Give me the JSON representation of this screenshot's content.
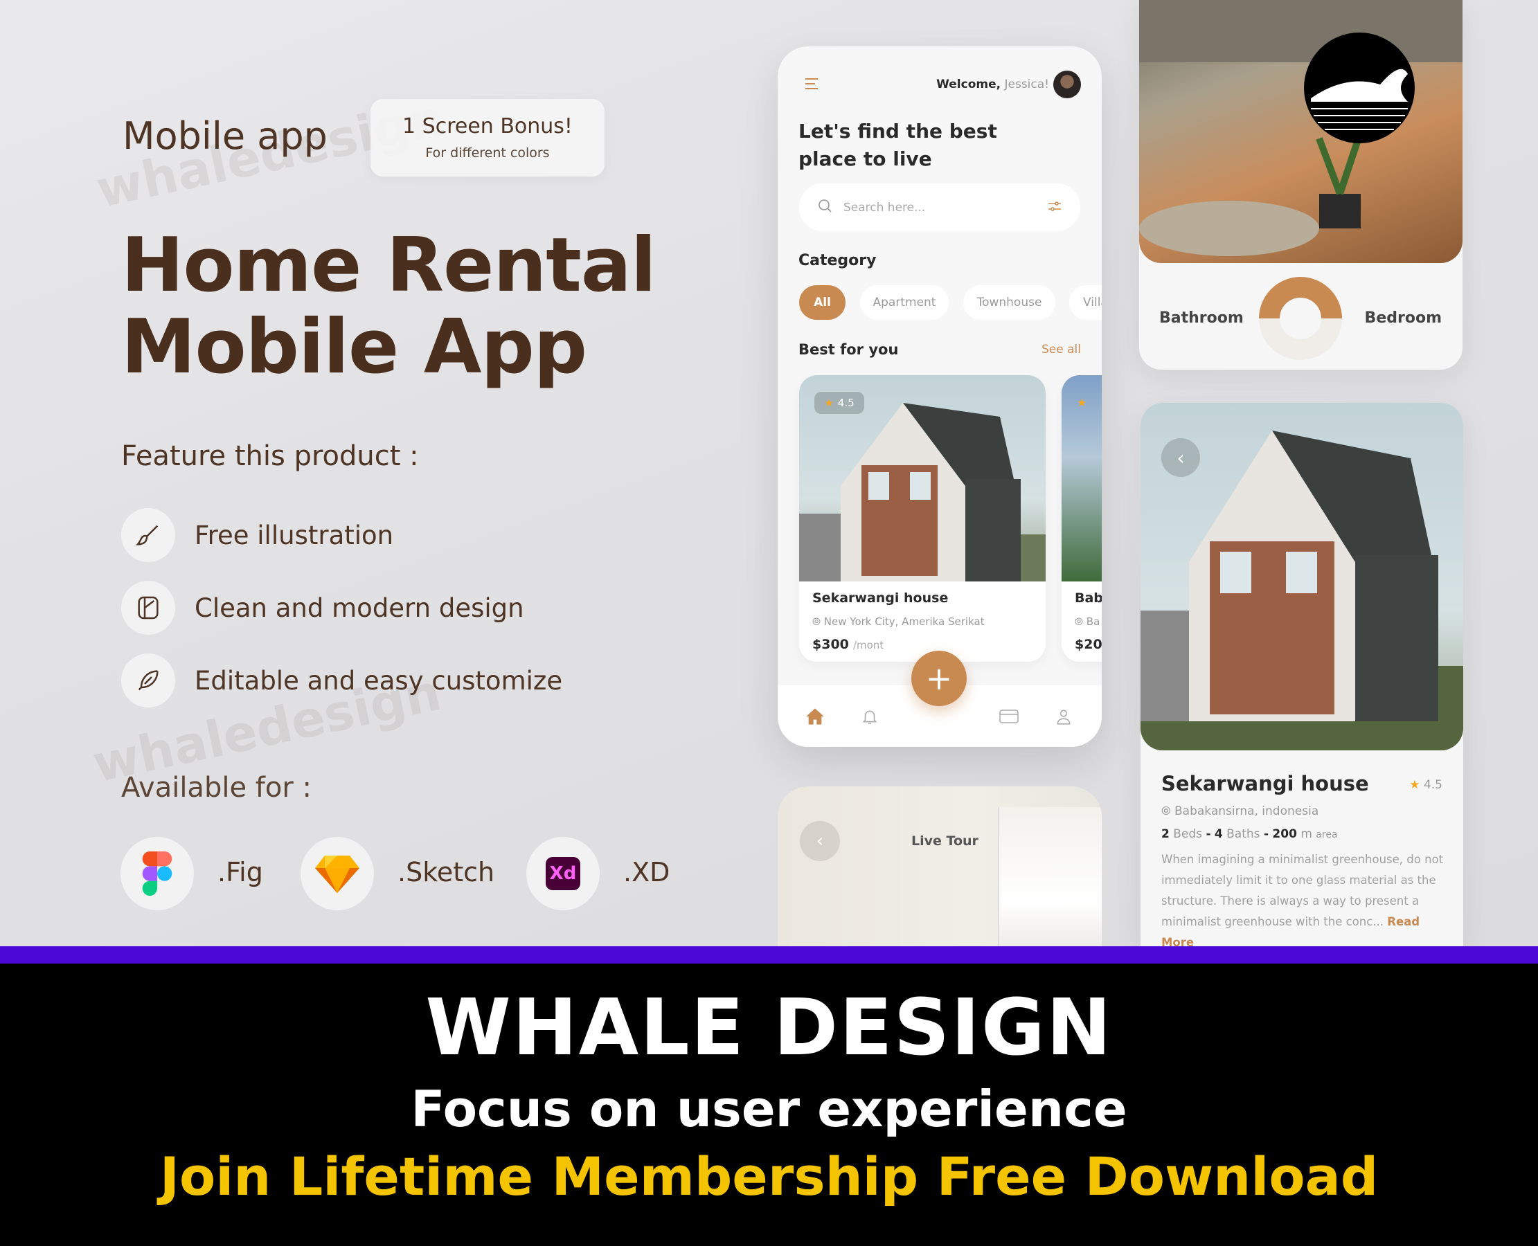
{
  "watermark": "whaledesign",
  "promo": {
    "subtitle": "Mobile app",
    "bonus_title": "1 Screen Bonus!",
    "bonus_sub": "For different colors",
    "title_line1": "Home Rental",
    "title_line2": "Mobile App",
    "features_heading": "Feature this product :",
    "features": [
      {
        "icon": "brush-icon",
        "label": "Free illustration"
      },
      {
        "icon": "design-tool-icon",
        "label": "Clean and modern design"
      },
      {
        "icon": "feather-pen-icon",
        "label": "Editable and easy customize"
      }
    ],
    "available_heading": "Available for :",
    "platforms": [
      {
        "icon": "figma-icon",
        "label": ".Fig"
      },
      {
        "icon": "sketch-icon",
        "label": ".Sketch"
      },
      {
        "icon": "adobe-xd-icon",
        "label": ".XD",
        "glyph": "Xd"
      }
    ]
  },
  "home_screen": {
    "welcome": "Welcome,",
    "user": "Jessica!",
    "heading_line1": "Let's find the best",
    "heading_line2": "place to live",
    "search_placeholder": "Search here...",
    "category_label": "Category",
    "categories": [
      "All",
      "Apartment",
      "Townhouse",
      "Villa"
    ],
    "selected_category": "All",
    "best_label": "Best for you",
    "see_all": "See all",
    "cards": [
      {
        "rating": "4.5",
        "name": "Sekarwangi house",
        "location": "New York City, Amerika Serikat",
        "price": "$300",
        "unit": "/mont"
      },
      {
        "name": "Bab",
        "location": "Ba",
        "price": "$20"
      }
    ],
    "nav": [
      "home-icon",
      "bell-icon",
      "card-icon",
      "user-icon"
    ],
    "accent": "#c98a52"
  },
  "tour_screen": {
    "label": "Live Tour"
  },
  "room_card": {
    "left": "Bathroom",
    "right": "Bedroom"
  },
  "detail_screen": {
    "name": "Sekarwangi house",
    "rating": "4.5",
    "location": "Babakansirna, indonesia",
    "beds": "2",
    "beds_label": "Beds",
    "baths": "4",
    "baths_label": "Baths",
    "area": "200",
    "area_unit": "m",
    "area_label": "area",
    "sep": "-",
    "description": "When imagining a minimalist greenhouse, do not immediately limit it to one glass material as the structure. There is always a way to present a minimalist greenhouse with the conc...",
    "read_more": "Read More"
  },
  "banner": {
    "brand": "WHALE DESIGN",
    "tagline": "Focus on user experience",
    "cta": "Join Lifetime Membership Free Download",
    "cta_color": "#f5c400",
    "bar_color": "#4b08d6"
  }
}
